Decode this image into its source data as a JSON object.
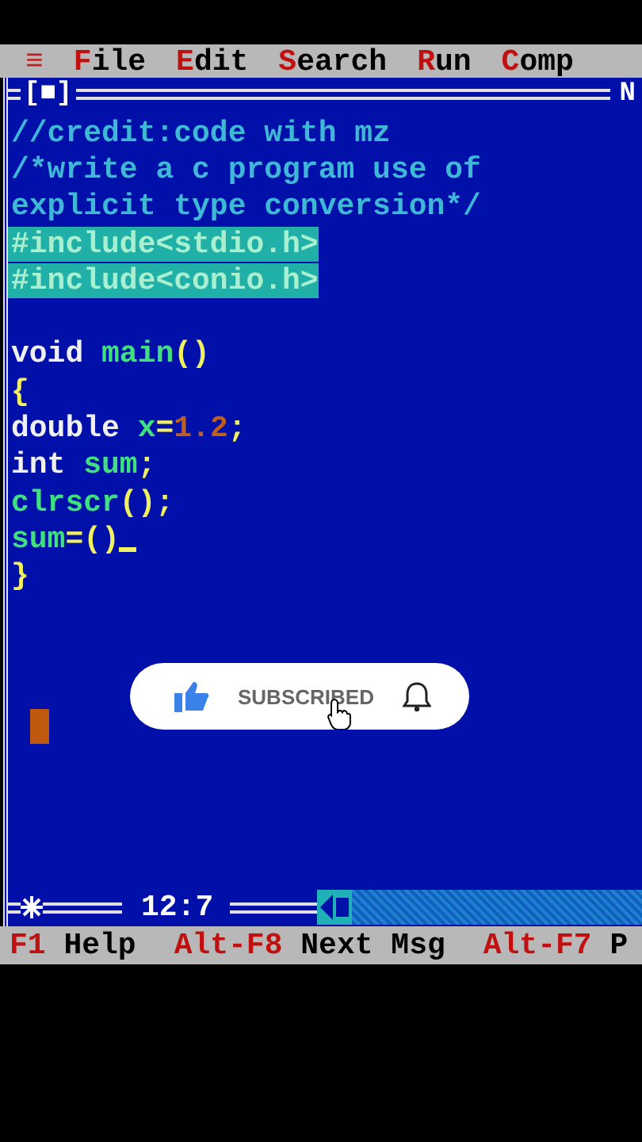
{
  "menu": [
    {
      "icon": "≡"
    },
    {
      "hotkey": "F",
      "rest": "ile"
    },
    {
      "hotkey": "E",
      "rest": "dit"
    },
    {
      "hotkey": "S",
      "rest": "earch"
    },
    {
      "hotkey": "R",
      "rest": "un"
    },
    {
      "hotkey": "C",
      "rest": "omp"
    }
  ],
  "editor": {
    "close_box": "[■]",
    "title": "N",
    "position": "12:7",
    "lines": [
      {
        "selected": false,
        "tokens": [
          {
            "kind": "comment",
            "text": "//credit:code with mz"
          }
        ]
      },
      {
        "selected": false,
        "tokens": [
          {
            "kind": "comment",
            "text": "/*write a c program use of"
          }
        ]
      },
      {
        "selected": false,
        "tokens": [
          {
            "kind": "comment",
            "text": "explicit type conversion*/"
          }
        ]
      },
      {
        "selected": true,
        "tokens": [
          {
            "kind": "preproc",
            "text": "#include<stdio.h>"
          }
        ]
      },
      {
        "selected": true,
        "tokens": [
          {
            "kind": "preproc",
            "text": "#include<conio.h>"
          }
        ]
      },
      {
        "selected": false
      },
      {
        "selected": false,
        "tokens": [
          {
            "kind": "keyword",
            "text": "void "
          },
          {
            "kind": "ident",
            "text": "main"
          },
          {
            "kind": "symbol",
            "text": "()"
          }
        ]
      },
      {
        "selected": false,
        "tokens": [
          {
            "kind": "symbol",
            "text": "{"
          }
        ]
      },
      {
        "selected": false,
        "tokens": [
          {
            "kind": "keyword",
            "text": "double "
          },
          {
            "kind": "ident",
            "text": "x"
          },
          {
            "kind": "symbol",
            "text": "="
          },
          {
            "kind": "number",
            "text": "1.2"
          },
          {
            "kind": "symbol",
            "text": ";"
          }
        ]
      },
      {
        "selected": false,
        "tokens": [
          {
            "kind": "keyword",
            "text": "int "
          },
          {
            "kind": "ident",
            "text": "sum"
          },
          {
            "kind": "symbol",
            "text": ";"
          }
        ]
      },
      {
        "selected": false,
        "tokens": [
          {
            "kind": "ident",
            "text": "clrscr"
          },
          {
            "kind": "symbol",
            "text": "();"
          }
        ]
      },
      {
        "selected": false,
        "cursor": true,
        "tokens": [
          {
            "kind": "ident",
            "text": "sum"
          },
          {
            "kind": "symbol",
            "text": "=()"
          }
        ]
      },
      {
        "selected": false,
        "tokens": [
          {
            "kind": "symbol",
            "text": "}"
          }
        ]
      }
    ]
  },
  "subscribe_popup": {
    "label": "SUBSCRIBED"
  },
  "status_bar": [
    {
      "key": "F1",
      "label": "Help"
    },
    {
      "key": "Alt-F8",
      "label": "Next Msg"
    },
    {
      "key": "Alt-F7",
      "label": "P"
    }
  ]
}
